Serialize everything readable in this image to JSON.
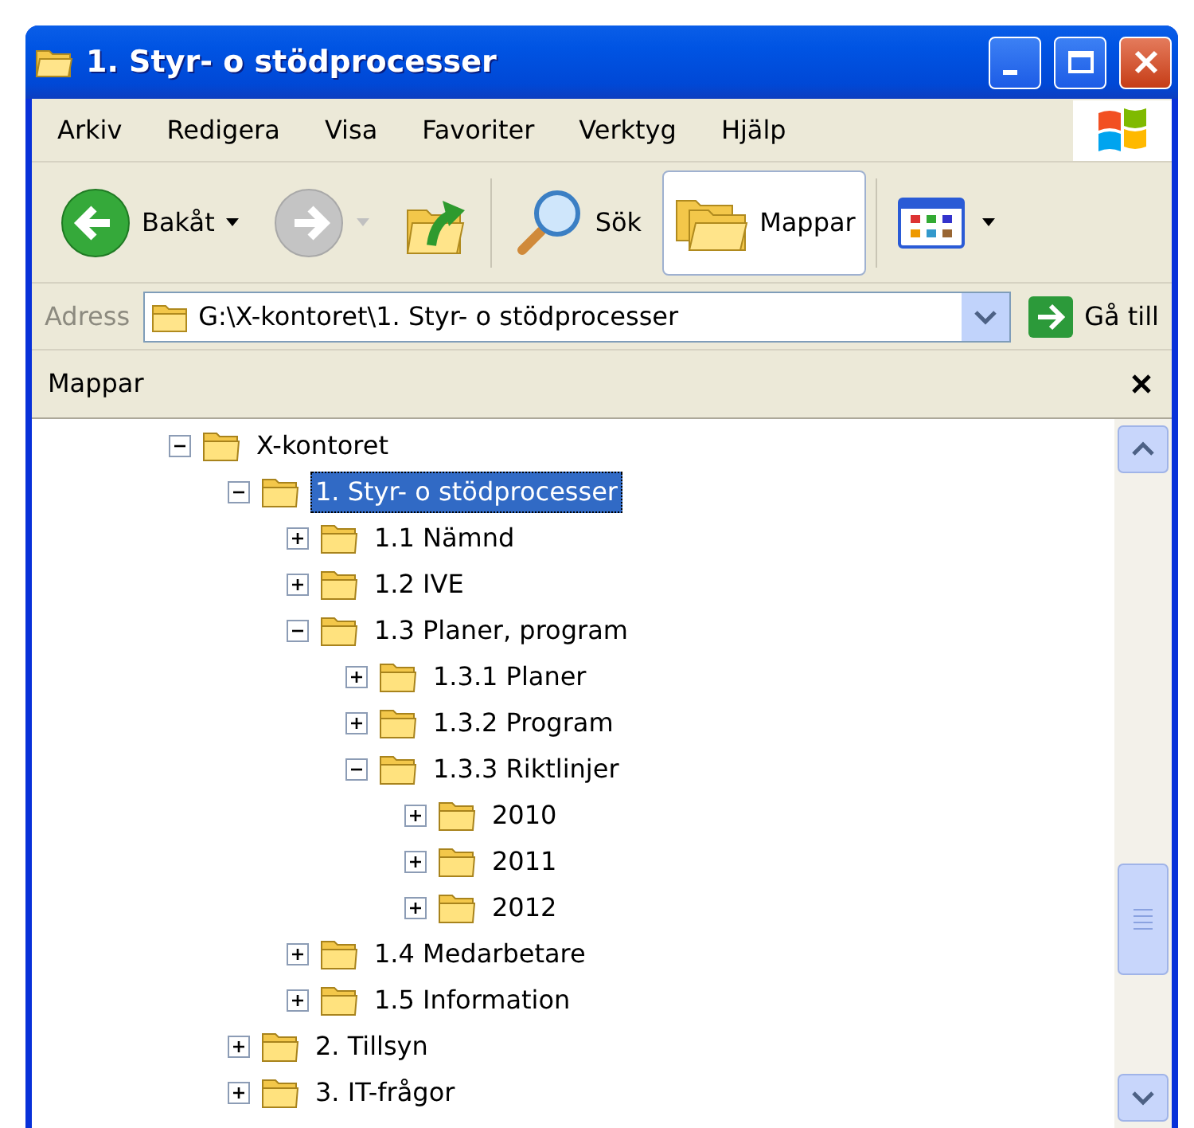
{
  "window": {
    "title": "1. Styr- o stödprocesser"
  },
  "menu": [
    "Arkiv",
    "Redigera",
    "Visa",
    "Favoriter",
    "Verktyg",
    "Hjälp"
  ],
  "toolbar": [
    {
      "kind": "back",
      "label": "Bakåt"
    },
    {
      "kind": "forward",
      "disabled": true
    },
    {
      "kind": "up"
    },
    {
      "kind": "search",
      "label": "Sök",
      "selected": false
    },
    {
      "kind": "folders",
      "label": "Mappar",
      "selected": true
    },
    {
      "kind": "views"
    }
  ],
  "address": {
    "label": "Adress",
    "value": "G:\\X-kontoret\\1. Styr- o stödprocesser",
    "go": "Gå till"
  },
  "panel": {
    "title": "Mappar"
  },
  "tree": [
    {
      "label": "X-kontoret",
      "expanded": true,
      "selected": false,
      "children": [
        {
          "label": "1. Styr- o stödprocesser",
          "expanded": true,
          "selected": true,
          "children": [
            {
              "label": "1.1 Nämnd",
              "expanded": false,
              "selected": false
            },
            {
              "label": "1.2 IVE",
              "expanded": false,
              "selected": false
            },
            {
              "label": "1.3 Planer, program",
              "expanded": true,
              "selected": false,
              "children": [
                {
                  "label": "1.3.1 Planer",
                  "expanded": false,
                  "selected": false
                },
                {
                  "label": "1.3.2 Program",
                  "expanded": false,
                  "selected": false
                },
                {
                  "label": "1.3.3 Riktlinjer",
                  "expanded": true,
                  "selected": false,
                  "children": [
                    {
                      "label": "2010",
                      "expanded": false,
                      "selected": false
                    },
                    {
                      "label": "2011",
                      "expanded": false,
                      "selected": false
                    },
                    {
                      "label": "2012",
                      "expanded": false,
                      "selected": false
                    }
                  ]
                }
              ]
            },
            {
              "label": "1.4 Medarbetare",
              "expanded": false,
              "selected": false
            },
            {
              "label": "1.5 Information",
              "expanded": false,
              "selected": false
            }
          ]
        },
        {
          "label": "2. Tillsyn",
          "expanded": false,
          "selected": false
        },
        {
          "label": "3. IT-frågor",
          "expanded": false,
          "selected": false
        }
      ]
    }
  ]
}
